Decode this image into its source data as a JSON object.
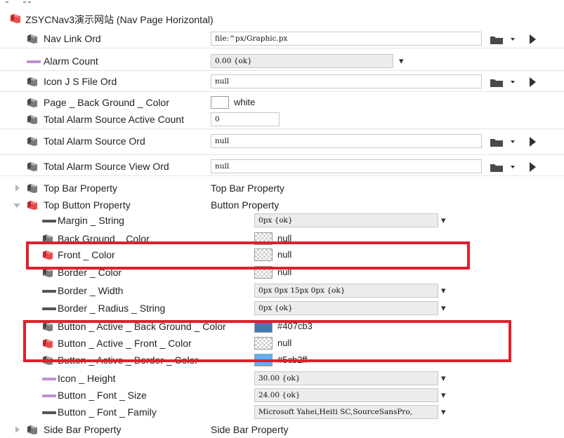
{
  "root": {
    "label": "ZSYCNav3演示网站 (Nav Page Horizontal)",
    "icon": "component-icon"
  },
  "rows_top": [
    {
      "id": "nav-link-ord",
      "label": "Nav Link Ord",
      "icon": "slot-icon",
      "value": "file:^px/Graphic.px",
      "editor": "ord"
    },
    {
      "id": "alarm-count",
      "label": "Alarm Count",
      "icon": "numeric-slot-icon",
      "value": "0.00 {ok}",
      "editor": "status"
    },
    {
      "id": "icon-js-file-ord",
      "label": "Icon J S File Ord",
      "icon": "slot-icon",
      "value": "null",
      "editor": "ord"
    },
    {
      "id": "page-background-color",
      "label": "Page _ Back Ground _ Color",
      "icon": "slot-icon",
      "value": "white",
      "editor": "color"
    },
    {
      "id": "total-alarm-source-active-count",
      "label": "Total Alarm Source Active Count",
      "icon": "slot-icon",
      "value": "0",
      "editor": "int"
    },
    {
      "id": "total-alarm-source-ord",
      "label": "Total Alarm Source Ord",
      "icon": "slot-icon",
      "value": "null",
      "editor": "ord"
    },
    {
      "id": "total-alarm-source-view-ord",
      "label": "Total Alarm Source View Ord",
      "icon": "slot-icon",
      "value": "null",
      "editor": "ord"
    }
  ],
  "top_bar": {
    "label": "Top Bar Property",
    "value": "Top Bar Property"
  },
  "top_button": {
    "label": "Top Button Property",
    "value": "Button Property"
  },
  "children": [
    {
      "id": "margin-string",
      "label": "Margin _ String",
      "icon": "string-slot-icon",
      "value": "0px {ok}",
      "editor": "status"
    },
    {
      "id": "background-color",
      "label": "Back Ground _ Color",
      "icon": "slot-icon",
      "value": "null",
      "editor": "swatch",
      "swatch": "checker"
    },
    {
      "id": "front-color",
      "label": "Front _ Color",
      "icon": "red-slot-icon",
      "value": "null",
      "editor": "swatch",
      "swatch": "checker"
    },
    {
      "id": "border-color",
      "label": "Border _ Color",
      "icon": "slot-icon",
      "value": "null",
      "editor": "swatch",
      "swatch": "checker"
    },
    {
      "id": "border-width",
      "label": "Border _ Width",
      "icon": "string-slot-icon",
      "value": "0px 0px 15px 0px {ok}",
      "editor": "status"
    },
    {
      "id": "border-radius-string",
      "label": "Border _ Radius _ String",
      "icon": "string-slot-icon",
      "value": "0px {ok}",
      "editor": "status"
    },
    {
      "id": "button-active-background-color",
      "label": "Button _ Active _ Back Ground _ Color",
      "icon": "slot-icon",
      "value": "#407cb3",
      "editor": "swatch",
      "swatch": "#407cb3"
    },
    {
      "id": "button-active-front-color",
      "label": "Button _ Active _ Front _ Color",
      "icon": "red-slot-icon",
      "value": "null",
      "editor": "swatch",
      "swatch": "checker"
    },
    {
      "id": "button-active-border-color",
      "label": "Button _ Active _ Border _ Color",
      "icon": "slot-icon",
      "value": "#5cb2ff",
      "editor": "swatch",
      "swatch": "#5cb2ff"
    },
    {
      "id": "icon-height",
      "label": "Icon _ Height",
      "icon": "numeric-slot-icon",
      "value": "30.00 {ok}",
      "editor": "status"
    },
    {
      "id": "button-font-size",
      "label": "Button _ Font _ Size",
      "icon": "numeric-slot-icon",
      "value": "24.00 {ok}",
      "editor": "status"
    },
    {
      "id": "button-font-family",
      "label": "Button _ Font _ Family",
      "icon": "string-slot-icon",
      "value": "Microsoft Yahei,Heiti SC,SourceSansPro,",
      "editor": "status"
    }
  ],
  "side_bar": {
    "label": "Side Bar Property",
    "value": "Side Bar Property"
  },
  "menu_glyph": "▾",
  "colors": {
    "highlight": "#e0202a",
    "accent": "#407cb3",
    "accent2": "#5cb2ff",
    "string_slot": "#555555",
    "numeric_slot": "#c08fd0"
  }
}
